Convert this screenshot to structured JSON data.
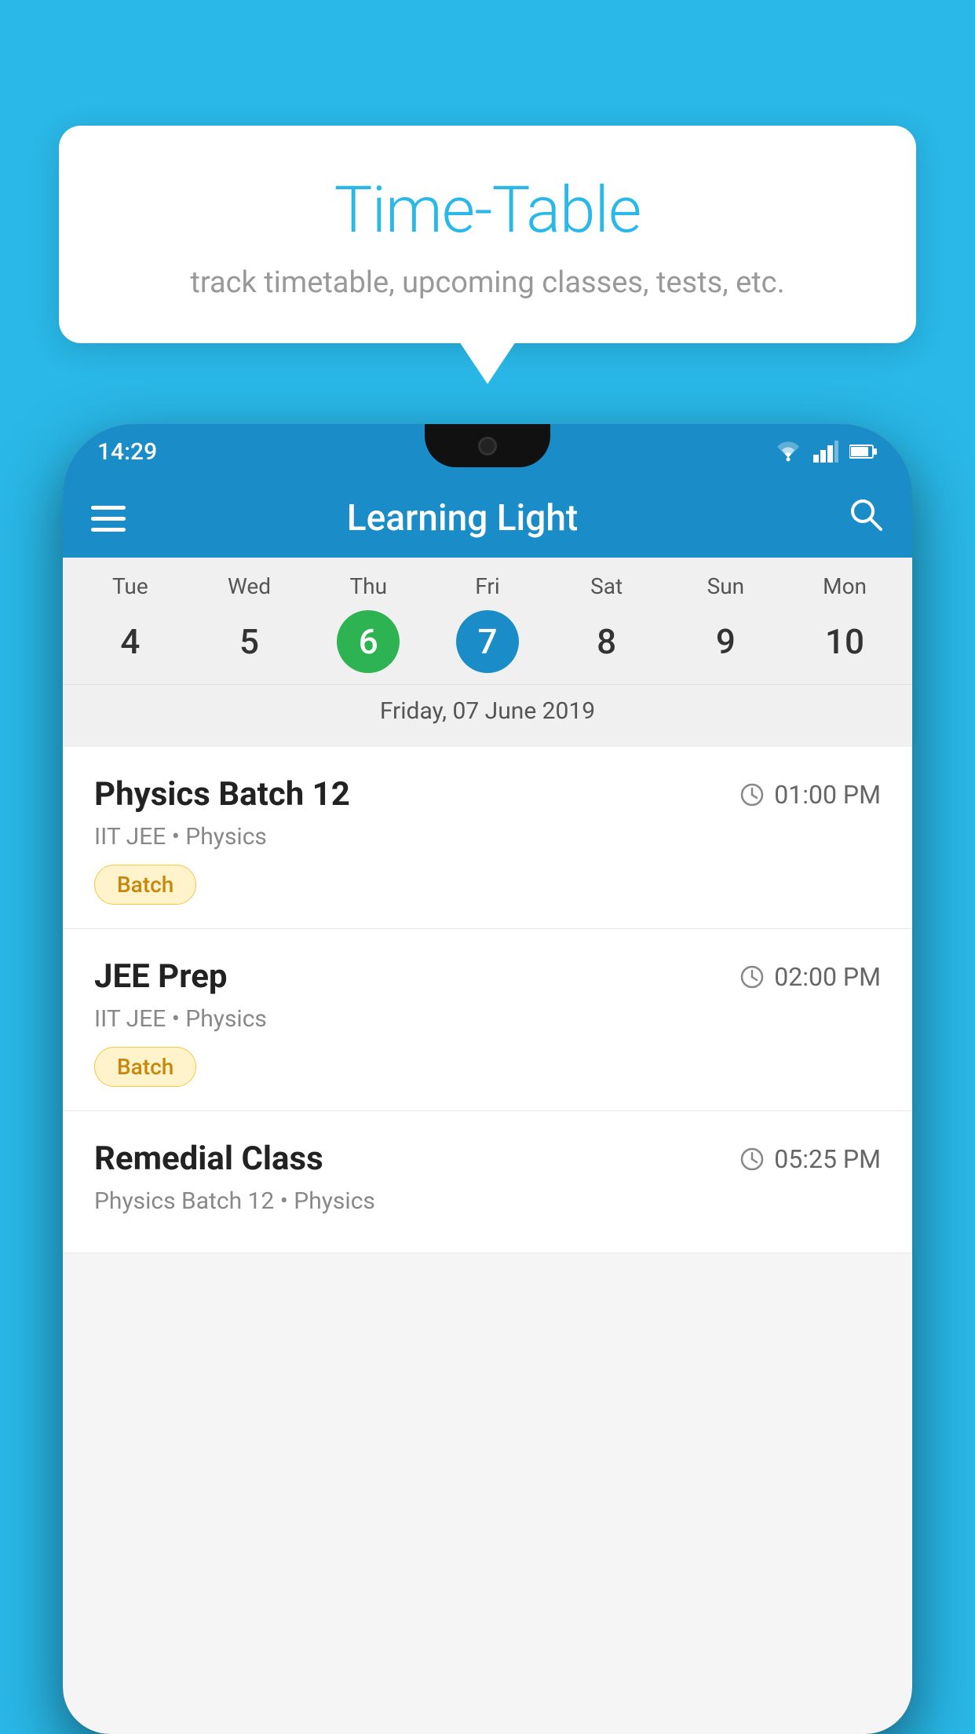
{
  "background_color": "#29b8e8",
  "tooltip": {
    "title": "Time-Table",
    "subtitle": "track timetable, upcoming classes, tests, etc."
  },
  "phone": {
    "status_bar": {
      "time": "14:29"
    },
    "header": {
      "title": "Learning Light"
    },
    "calendar": {
      "days": [
        {
          "name": "Tue",
          "num": "4",
          "state": "normal"
        },
        {
          "name": "Wed",
          "num": "5",
          "state": "normal"
        },
        {
          "name": "Thu",
          "num": "6",
          "state": "today"
        },
        {
          "name": "Fri",
          "num": "7",
          "state": "selected"
        },
        {
          "name": "Sat",
          "num": "8",
          "state": "normal"
        },
        {
          "name": "Sun",
          "num": "9",
          "state": "normal"
        },
        {
          "name": "Mon",
          "num": "10",
          "state": "normal"
        }
      ],
      "selected_date_label": "Friday, 07 June 2019"
    },
    "schedule": [
      {
        "title": "Physics Batch 12",
        "time": "01:00 PM",
        "sub": "IIT JEE • Physics",
        "badge": "Batch"
      },
      {
        "title": "JEE Prep",
        "time": "02:00 PM",
        "sub": "IIT JEE • Physics",
        "badge": "Batch"
      },
      {
        "title": "Remedial Class",
        "time": "05:25 PM",
        "sub": "Physics Batch 12 • Physics",
        "badge": null
      }
    ]
  }
}
